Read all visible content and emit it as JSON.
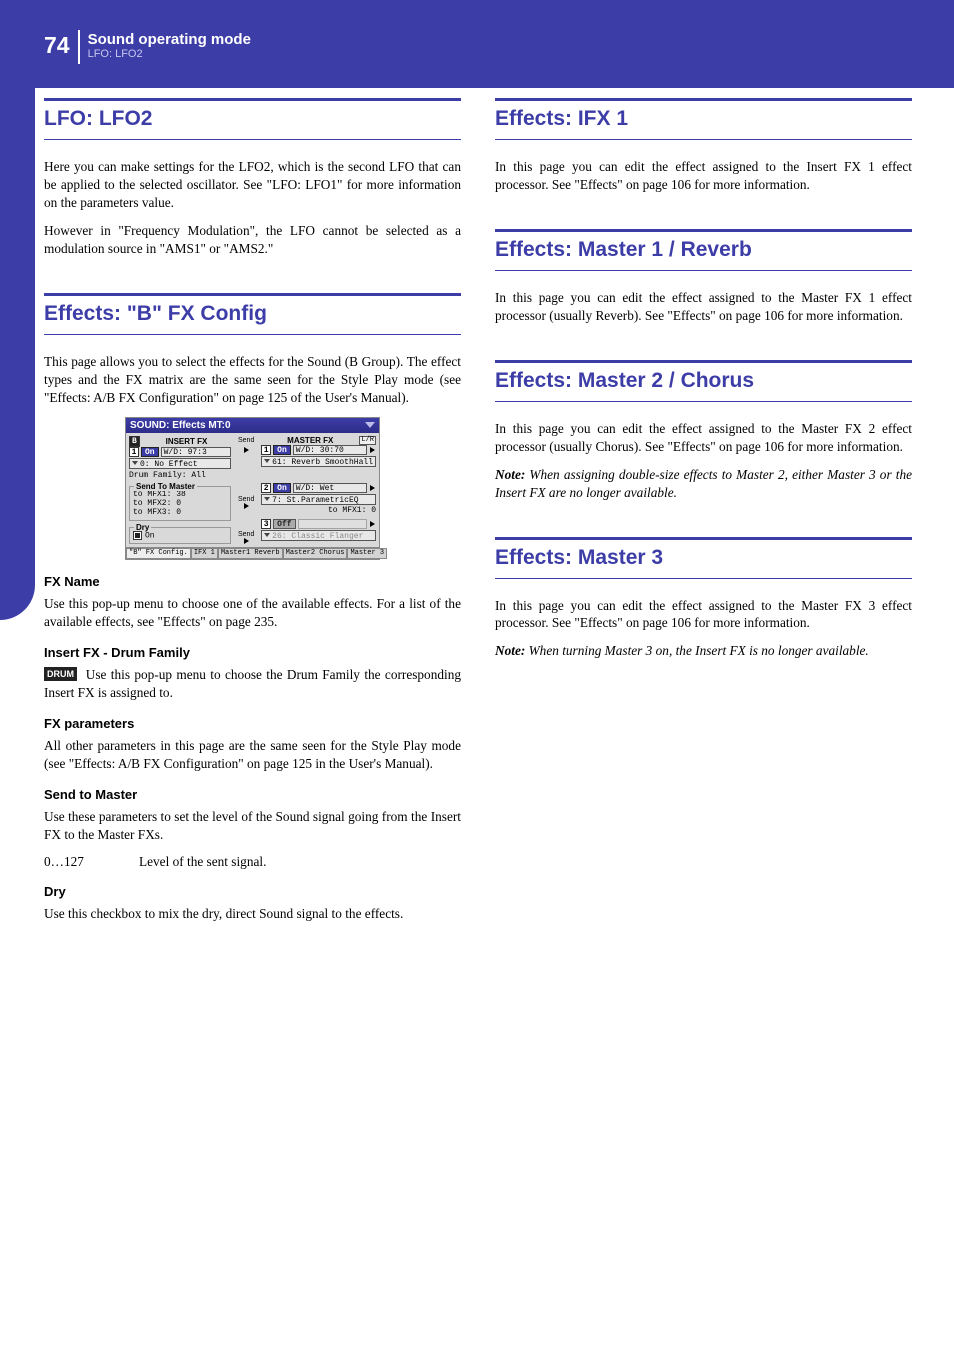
{
  "header": {
    "page_number": "74",
    "title": "Sound operating mode",
    "subtitle": "LFO: LFO2"
  },
  "left": {
    "lfo2": {
      "heading": "LFO: LFO2",
      "p1": "Here you can make settings for the LFO2, which is the second LFO that can be applied to the selected oscillator. See \"LFO: LFO1\" for more information on the parameters value.",
      "p2": "However in \"Frequency Modulation\", the LFO cannot be selected as a modulation source in \"AMS1\" or \"AMS2.\""
    },
    "bfx": {
      "heading": "Effects: \"B\" FX Config",
      "p1": "This page allows you to select the effects for the Sound (B Group). The effect types and the FX matrix are the same seen for the Style Play mode (see \"Effects: A/B FX Configuration\" on page 125 of the User's Manual).",
      "fxname_h": "FX Name",
      "fxname_p": "Use this pop-up menu to choose one of the available effects. For a list of the available effects, see \"Effects\" on page 235.",
      "insert_h": "Insert FX - Drum Family",
      "insert_badge": "DRUM",
      "insert_p": "Use this pop-up menu to choose the Drum Family the corresponding Insert FX is assigned to.",
      "fxparam_h": "FX parameters",
      "fxparam_p": "All other parameters in this page are the same seen for the Style Play mode (see \"Effects: A/B FX Configuration\" on page 125 in the User's Manual).",
      "send_h": "Send to Master",
      "send_p": "Use these parameters to set the level of the Sound signal going from the Insert FX to the Master FXs.",
      "send_range": "0…127",
      "send_range_desc": "Level of the sent signal.",
      "dry_h": "Dry",
      "dry_p": "Use this checkbox to mix the dry, direct Sound signal to the effects."
    },
    "screenshot": {
      "title": "SOUND: Effects    MT:0",
      "insert_label": "INSERT FX",
      "master_label": "MASTER FX",
      "send_label": "Send",
      "lr": "L/R",
      "row1": {
        "num": "1",
        "on": "On",
        "wd": "W/D: 97:3"
      },
      "ins_fx": "0: No Effect",
      "drum_family": "Drum Family: All",
      "mrow1": {
        "num": "1",
        "on": "On",
        "wd": "W/D: 30:70"
      },
      "mfx1": "61: Reverb SmoothHall",
      "stm_title": "Send To Master",
      "stm1": "to MFX1:  38",
      "stm2": "to MFX2:   0",
      "stm3": "to MFX3:   0",
      "mrow2": {
        "num": "2",
        "on": "On",
        "wd": "W/D:  Wet"
      },
      "mfx2": "7: St.ParametricEQ",
      "to_mfx1": "to MFX1:   0",
      "mrow3": {
        "num": "3",
        "off": "Off"
      },
      "mfx3": "26: Classic Flanger",
      "dry_title": "Dry",
      "dry_on": "On",
      "tabs": [
        "\"B\" FX\nConfig.",
        "IFX 1",
        "Master1\nReverb",
        "Master2\nChorus",
        "Master\n3"
      ]
    }
  },
  "right": {
    "ifx1": {
      "heading": "Effects: IFX 1",
      "p1": "In this page you can edit the effect assigned to the Insert FX 1 effect processor. See \"Effects\" on page 106 for more information."
    },
    "m1": {
      "heading": "Effects: Master 1 / Reverb",
      "p1": "In this page you can edit the effect assigned to the Master FX 1 effect processor (usually Reverb). See \"Effects\" on page 106 for more information."
    },
    "m2": {
      "heading": "Effects: Master 2 / Chorus",
      "p1": "In this page you can edit the effect assigned to the Master FX 2 effect processor (usually Chorus). See \"Effects\" on page 106 for more information.",
      "note_label": "Note:",
      "note": " When assigning double-size effects to Master 2, either Master 3 or the Insert FX are no longer available."
    },
    "m3": {
      "heading": "Effects: Master 3",
      "p1": "In this page you can edit the effect assigned to the Master FX 3 effect processor. See \"Effects\" on page 106 for more information.",
      "note_label": "Note:",
      "note": " When turning Master 3 on, the Insert FX is no longer available."
    }
  }
}
